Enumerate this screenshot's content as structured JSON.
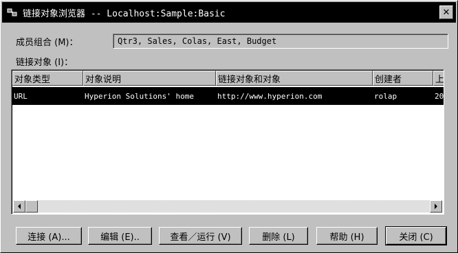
{
  "window": {
    "title": "链接对象浏览器 -- Localhost:Sample:Basic",
    "close_label": "✕"
  },
  "member_combo": {
    "label": "成员组合 (M)：",
    "value": "Qtr3, Sales, Colas, East, Budget"
  },
  "linked_objects": {
    "label": "链接对象 (I)：",
    "columns": [
      "对象类型",
      "对象说明",
      "链接对象和对象",
      "创建者",
      "上"
    ],
    "rows": [
      [
        "URL",
        "Hyperion Solutions' home",
        "http://www.hyperion.com",
        "rolap",
        "20"
      ]
    ]
  },
  "buttons": {
    "connect": "连接 (A)...",
    "edit": "编辑 (E)..",
    "view_run": "查看／运行 (V)",
    "delete": "删除 (L)",
    "help": "帮助 (H)",
    "close": "关闭 (C)"
  },
  "colors": {
    "face": "#c0c0c0",
    "titlebar": "#000000",
    "selection": "#000000"
  }
}
